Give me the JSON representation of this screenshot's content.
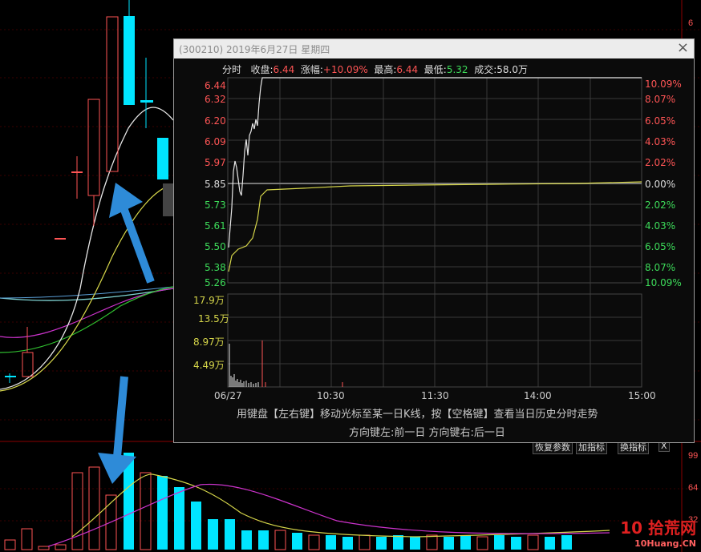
{
  "window": {
    "title": "(300210) 2019年6月27日 星期四",
    "close_symbol": "×"
  },
  "info": {
    "mode": "分时",
    "close_label": "收盘:",
    "close_value": "6.44",
    "change_label": "涨幅:",
    "change_value": "+10.09%",
    "high_label": "最高:",
    "high_value": "6.44",
    "low_label": "最低:",
    "low_value": "5.32",
    "volume_label": "成交:",
    "volume_value": "58.0万"
  },
  "price_axis": {
    "left": [
      "6.44",
      "6.32",
      "6.20",
      "6.09",
      "5.97",
      "5.85",
      "5.73",
      "5.61",
      "5.50",
      "5.38",
      "5.26"
    ],
    "right": [
      "10.09%",
      "8.07%",
      "6.05%",
      "4.03%",
      "2.02%",
      "0.00%",
      "2.02%",
      "4.03%",
      "6.05%",
      "8.07%",
      "10.09%"
    ],
    "prev_close": "5.85"
  },
  "volume_axis": [
    "17.9万",
    "13.5万",
    "8.97万",
    "4.49万"
  ],
  "time_axis": [
    "06/27",
    "10:30",
    "11:30",
    "14:00",
    "15:00"
  ],
  "hints": {
    "line1": "用键盘【左右键】移动光标至某一日K线，按【空格键】查看当日历史分时走势",
    "line2": "方向键左:前一日   方向键右:后一日"
  },
  "toolbar": {
    "btn1": "恢复参数",
    "btn2": "加指标",
    "btn3": "换指标",
    "btn4": "X"
  },
  "watermark": {
    "logo": "10",
    "text": "拾荒网",
    "domain": "10Huang.CN"
  },
  "colors": {
    "rise": "#ff5555",
    "fall": "#3ddc5a",
    "candle_down": "#00e5ff",
    "arrow": "#2e8bd8"
  }
}
